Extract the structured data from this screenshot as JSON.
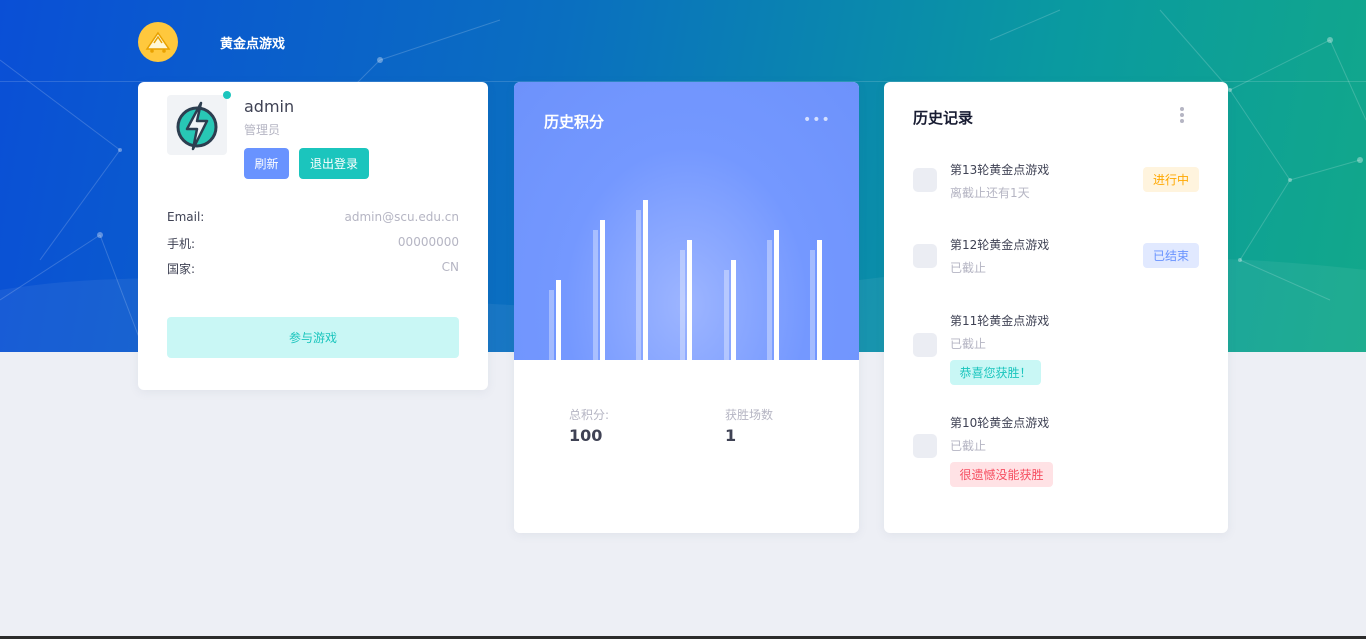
{
  "header": {
    "brand": "黄金点游戏",
    "logo_icon": "gold-cart-icon"
  },
  "profile": {
    "username": "admin",
    "role": "管理员",
    "refresh_label": "刷新",
    "logout_label": "退出登录",
    "fields": [
      {
        "key": "Email:",
        "value": "admin@scu.edu.cn"
      },
      {
        "key": "手机:",
        "value": "00000000"
      },
      {
        "key": "国家:",
        "value": "CN"
      }
    ],
    "join_label": "参与游戏",
    "avatar_icon": "lightning-bolt-icon"
  },
  "score": {
    "title": "历史积分",
    "total_label": "总积分:",
    "total_value": "100",
    "wins_label": "获胜场数",
    "wins_value": "1"
  },
  "records": {
    "title": "历史记录",
    "items": [
      {
        "name": "第13轮黄金点游戏",
        "sub": "离截止还有1天",
        "badge": "进行中",
        "badge_type": "warning"
      },
      {
        "name": "第12轮黄金点游戏",
        "sub": "已截止",
        "badge": "已结束",
        "badge_type": "primary"
      },
      {
        "name": "第11轮黄金点游戏",
        "sub": "已截止",
        "badge": "恭喜您获胜！",
        "badge_type": "success"
      },
      {
        "name": "第10轮黄金点游戏",
        "sub": "已截止",
        "badge": "很遗憾没能获胜",
        "badge_type": "danger"
      }
    ]
  },
  "colors": {
    "primary": "#6993ff",
    "success": "#1bc5bd",
    "warning": "#ffa800",
    "danger": "#f64e60"
  }
}
